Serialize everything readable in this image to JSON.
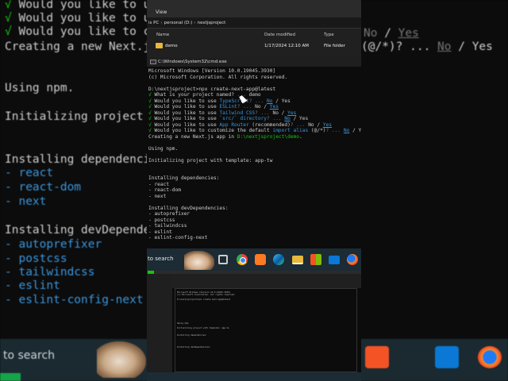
{
  "explorer": {
    "menu_view": "View",
    "breadcrumb": [
      "is PC",
      "personal (D:)",
      "nextjsproject"
    ],
    "columns": [
      "Name",
      "Date modified",
      "Type"
    ],
    "rows": [
      {
        "name": "demo",
        "date": "1/17/2024 12:10 AM",
        "type": "File folder"
      }
    ]
  },
  "cmd": {
    "title": "C:\\Windows\\System32\\cmd.exe",
    "lines": {
      "l1": "Microsoft Windows [Version 10.0.19045.3930]",
      "l2": "(c) Microsoft Corporation. All rights reserved.",
      "l3": "D:\\nextjsproject>npx create-next-app@latest",
      "q1a": "√ ",
      "q1b": "What is your project named? ",
      "q1c": "... ",
      "q1d": "demo",
      "q2": "Would you like to use ",
      "q2k": "TypeScript",
      "q2r": "? ... ",
      "q2n": "No",
      "q2s": " / ",
      "q2y": "Yes",
      "q3k": "ESLint",
      "q4k": "Tailwind CSS",
      "q5k": "`src/` directory",
      "q6k": "App Router",
      "q6x": " (recommended)",
      "q7": "Would you like to customize the default ",
      "q7k": "import alias",
      "q7x": " (@/*)",
      "create": "Creating a new Next.js app in ",
      "create_path": "D:\\nextjsproject\\demo",
      "create_end": ".",
      "npm": "Using npm.",
      "init": "Initializing project with template: app-tw",
      "deps_head": "Installing dependencies:",
      "deps": [
        "- react",
        "- react-dom",
        "- next"
      ],
      "devdeps_head": "Installing devDependencies:",
      "devdeps": [
        "- autoprefixer",
        "- postcss",
        "- tailwindcss",
        "- eslint",
        "- eslint-config-next"
      ]
    }
  },
  "taskbar": {
    "search": "to search",
    "icons": [
      "task-view-icon",
      "chrome-icon",
      "xampp-icon",
      "edge-icon",
      "file-explorer-icon",
      "store-icon",
      "mail-icon",
      "firefox-icon"
    ]
  },
  "background": {
    "lines": {
      "b1": "Would you like to use",
      "b2": "Would you like to use",
      "b3": "Would you like to cust",
      "b3r": "(@/*)? ... ",
      "b3n": "No",
      "b3y": "Yes",
      "b4": "Creating a new Next.js",
      "b5": "Using npm.",
      "b6": "Initializing project w",
      "b7": "Installing dependencie",
      "b8": "- react",
      "b9": "- react-dom",
      "b10": "- next",
      "b11": "Installing devDependen",
      "b12": "- autoprefixer",
      "b13": "- postcss",
      "b14": "- tailwindcss",
      "b15": "- eslint",
      "b16": "- eslint-config-next",
      "r1": "No",
      "r1s": " / ",
      "r1y": "Yes",
      "search": "to search"
    }
  },
  "colors": {
    "check": "#16c60c",
    "cyan": "#3a96dd",
    "gray": "#767676",
    "terminal_bg": "#0c0c0c",
    "taskbar_bg": "#1c2b34"
  }
}
